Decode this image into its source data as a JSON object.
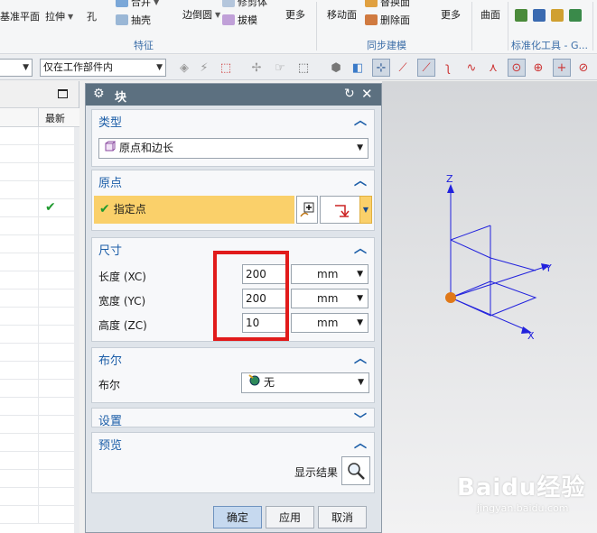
{
  "ribbon": {
    "items": {
      "datum_plane": "基准平面",
      "extrude": "拉伸",
      "hole": "孔",
      "unite": "合并",
      "shell": "抽壳",
      "edge_blend": "边倒圆",
      "draft": "拔模",
      "trim_body": "修剪体",
      "more_features": "更多",
      "move_face": "移动面",
      "replace_face": "替换面",
      "delete_face": "删除面",
      "more_sync": "更多",
      "surface": "曲面"
    },
    "groups": {
      "feature": "特征",
      "sync_modeling": "同步建模",
      "std_tools": "标准化工具 - G..."
    }
  },
  "toolbar": {
    "filter_left": "",
    "filter_scope": "仅在工作部件内"
  },
  "left_panel": {
    "column_latest": "最新"
  },
  "dialog": {
    "title": "块",
    "sections": {
      "type": {
        "title": "类型",
        "value": "原点和边长"
      },
      "origin": {
        "title": "原点",
        "point_label": "指定点"
      },
      "dimensions": {
        "title": "尺寸",
        "rows": [
          {
            "label": "长度 (XC)",
            "value": "200",
            "unit": "mm"
          },
          {
            "label": "宽度 (YC)",
            "value": "200",
            "unit": "mm"
          },
          {
            "label": "高度 (ZC)",
            "value": "10",
            "unit": "mm"
          }
        ]
      },
      "boolean": {
        "title": "布尔",
        "label": "布尔",
        "value": "无"
      },
      "settings": {
        "title": "设置"
      },
      "preview": {
        "title": "预览",
        "show_result_label": "显示结果"
      }
    },
    "buttons": {
      "ok": "确定",
      "apply": "应用",
      "cancel": "取消"
    }
  },
  "viewport": {
    "axes": {
      "x": "X",
      "y": "Y",
      "z": "Z"
    },
    "axis_color": "#2222dd",
    "origin_color": "#e07818"
  },
  "watermark": {
    "main": "Baidu经验",
    "sub": "jingyan.baidu.com"
  },
  "colors": {
    "highlight": "#e11b1b",
    "dialog_title_bg": "#5c7080",
    "section_title": "#1c5ea8",
    "point_field": "#fad06a"
  }
}
